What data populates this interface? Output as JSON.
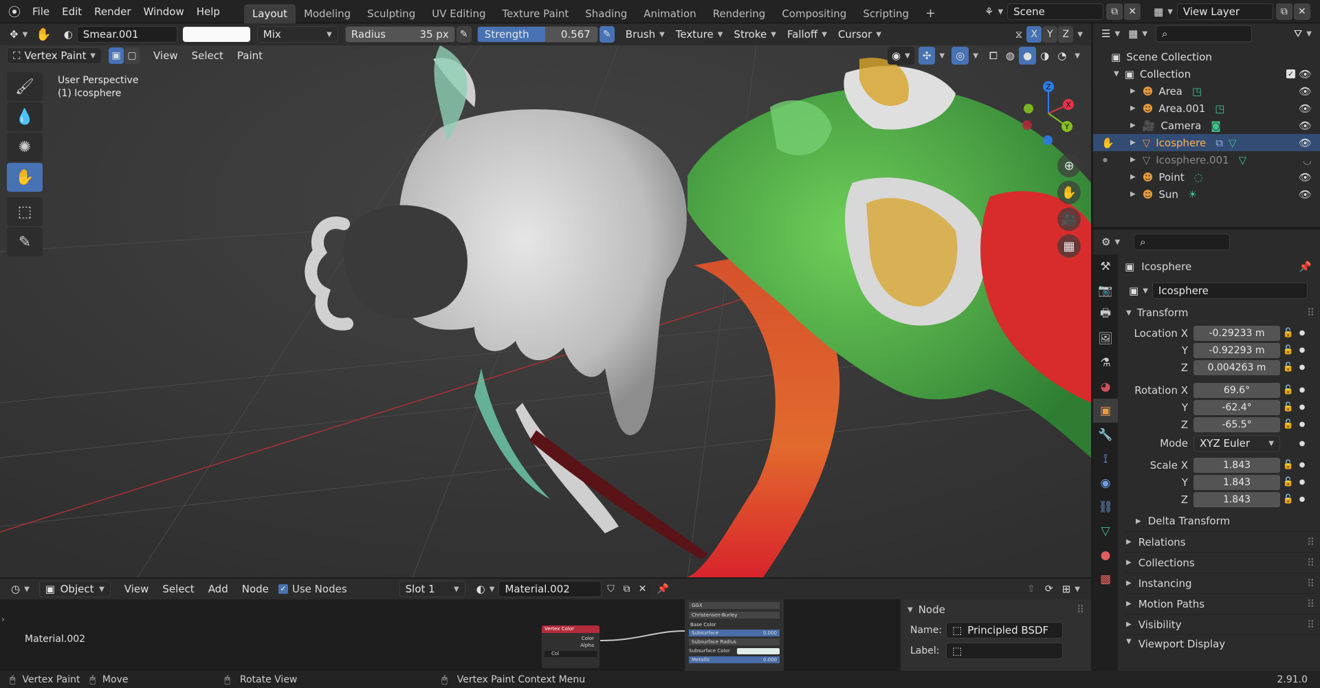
{
  "topbar": {
    "menus": [
      "File",
      "Edit",
      "Render",
      "Window",
      "Help"
    ],
    "tabs": [
      "Layout",
      "Modeling",
      "Sculpting",
      "UV Editing",
      "Texture Paint",
      "Shading",
      "Animation",
      "Rendering",
      "Compositing",
      "Scripting"
    ],
    "active_tab": "Layout",
    "scene": "Scene",
    "view_layer": "View Layer"
  },
  "tool_header": {
    "brush_name": "Smear.001",
    "blend_mode": "Mix",
    "radius_label": "Radius",
    "radius_value": "35 px",
    "strength_label": "Strength",
    "strength_value": "0.567",
    "strength_fraction": 0.567,
    "menus": [
      "Brush",
      "Texture",
      "Stroke",
      "Falloff",
      "Cursor"
    ],
    "axes": [
      "X",
      "Y",
      "Z"
    ]
  },
  "view_header": {
    "mode": "Vertex Paint",
    "menus": [
      "View",
      "Select",
      "Paint"
    ]
  },
  "viewport": {
    "perspective": "User Perspective",
    "object": "(1) Icosphere",
    "gizmo_axes": [
      "Z",
      "X",
      "Y"
    ]
  },
  "outliner": {
    "scene_collection": "Scene Collection",
    "collection": "Collection",
    "items": [
      {
        "name": "Area",
        "selected": false
      },
      {
        "name": "Area.001",
        "selected": false
      },
      {
        "name": "Camera",
        "selected": false
      },
      {
        "name": "Icosphere",
        "selected": true
      },
      {
        "name": "Icosphere.001",
        "selected": false
      },
      {
        "name": "Point",
        "selected": false
      },
      {
        "name": "Sun",
        "selected": false
      }
    ]
  },
  "properties": {
    "object_name": "Icosphere",
    "data_name": "Icosphere",
    "transform_label": "Transform",
    "location_label": "Location X",
    "location": [
      "-0.29233 m",
      "-0.92293 m",
      "0.004263 m"
    ],
    "rotation_label": "Rotation X",
    "rotation": [
      "69.6°",
      "-62.4°",
      "-65.5°"
    ],
    "mode_label": "Mode",
    "mode_value": "XYZ Euler",
    "scale_label": "Scale X",
    "scale": [
      "1.843",
      "1.843",
      "1.843"
    ],
    "axis_y": "Y",
    "axis_z": "Z",
    "delta_transform": "Delta Transform",
    "sections": [
      "Relations",
      "Collections",
      "Instancing",
      "Motion Paths",
      "Visibility",
      "Viewport Display"
    ]
  },
  "node_editor": {
    "type": "Object",
    "menus": [
      "View",
      "Select",
      "Add",
      "Node"
    ],
    "use_nodes": "Use Nodes",
    "slot": "Slot 1",
    "material": "Material.002",
    "material_label": "Material.002",
    "vertex_color_node": {
      "title": "Vertex Color",
      "outputs": [
        "Color",
        "Alpha"
      ],
      "layer": "Col"
    },
    "bsdf_node": {
      "distribution": "GGX",
      "subsurface_method": "Christensen-Burley",
      "inputs": [
        "Base Color",
        "Subsurface",
        "Subsurface Radius",
        "Subsurface Color",
        "Metallic"
      ],
      "subsurface_value": "0.000",
      "metallic_value": "0.000"
    },
    "panel_title": "Node",
    "name_label": "Name:",
    "name_value": "Principled BSDF",
    "label_label": "Label:"
  },
  "statusbar": {
    "left_action": "Vertex Paint",
    "mid_action": "Move",
    "rotate_action": "Rotate View",
    "context_action": "Vertex Paint Context Menu",
    "version": "2.91.0"
  },
  "colors": {
    "accent_blue": "#4772b3",
    "selection": "#334c73",
    "axis_x": "#e8334a",
    "axis_y": "#84c021",
    "axis_z": "#2d7de8"
  }
}
